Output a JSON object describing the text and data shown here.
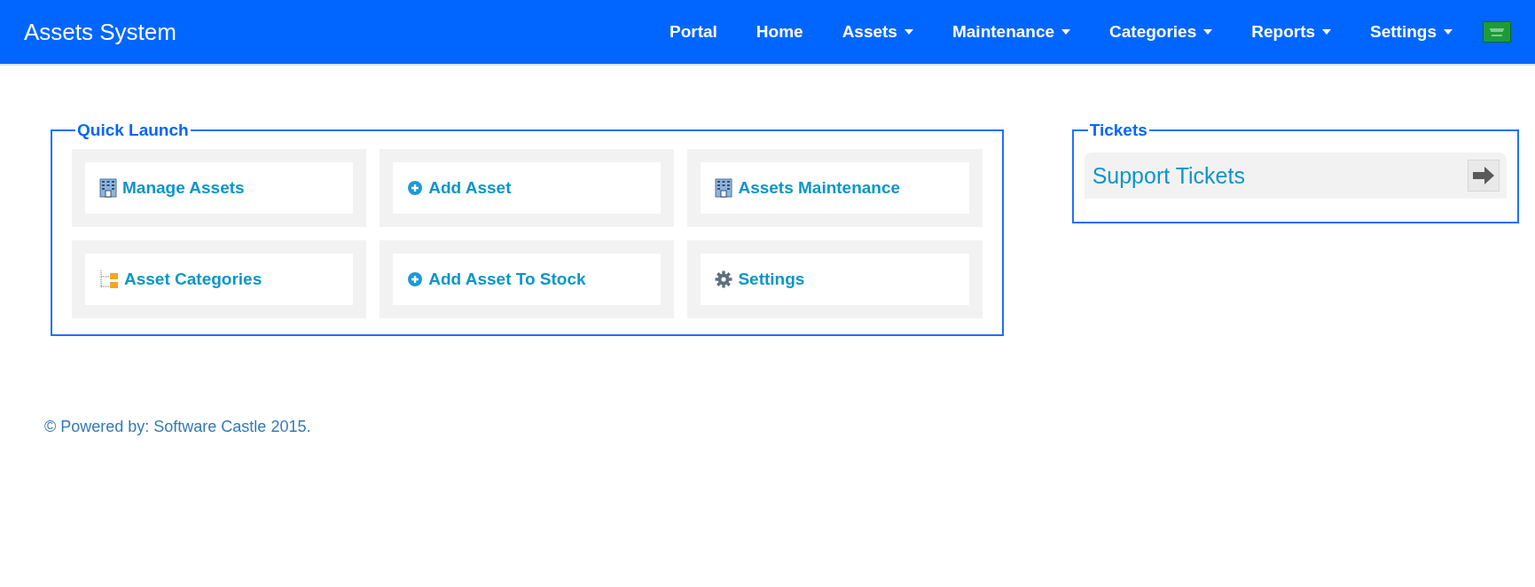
{
  "navbar": {
    "brand": "Assets System",
    "items": [
      {
        "label": "Portal",
        "dropdown": false
      },
      {
        "label": "Home",
        "dropdown": false
      },
      {
        "label": "Assets",
        "dropdown": true
      },
      {
        "label": "Maintenance",
        "dropdown": true
      },
      {
        "label": "Categories",
        "dropdown": true
      },
      {
        "label": "Reports",
        "dropdown": true
      },
      {
        "label": "Settings",
        "dropdown": true
      }
    ]
  },
  "quick_launch": {
    "title": "Quick Launch",
    "tiles": [
      {
        "label": "Manage Assets",
        "kind": "building"
      },
      {
        "label": "Add Asset",
        "kind": "add"
      },
      {
        "label": "Assets Maintenance",
        "kind": "building"
      },
      {
        "label": "Asset Categories",
        "kind": "tree"
      },
      {
        "label": "Add Asset To Stock",
        "kind": "add"
      },
      {
        "label": "Settings",
        "kind": "gear"
      }
    ]
  },
  "tickets": {
    "title": "Tickets",
    "links": [
      {
        "label": "Support Tickets"
      }
    ]
  },
  "footer": "© Powered by: Software Castle 2015."
}
